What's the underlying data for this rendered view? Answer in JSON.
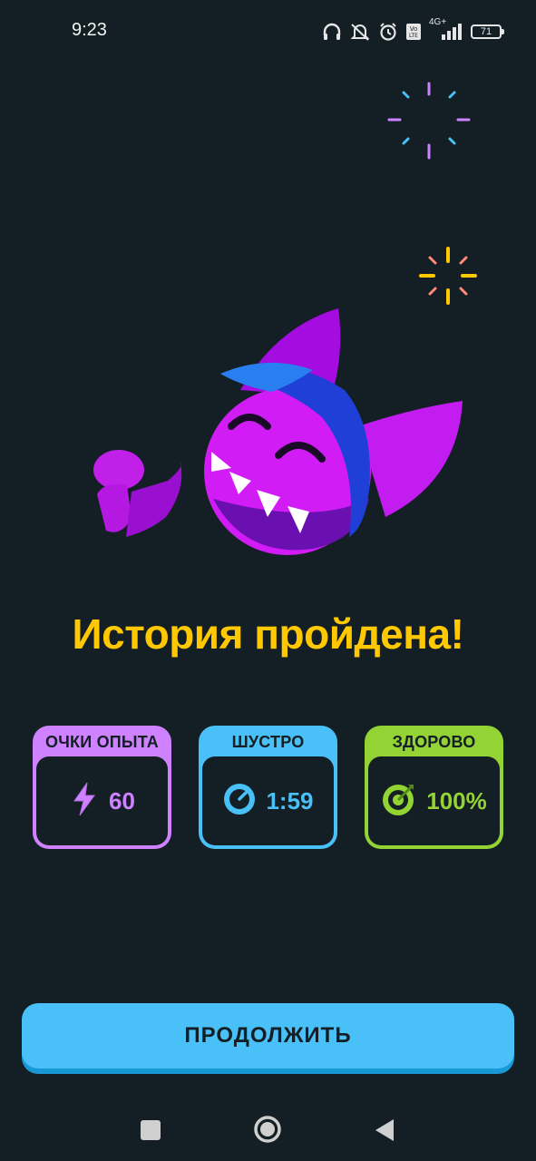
{
  "status_bar": {
    "time": "9:23",
    "battery": "71",
    "icons": [
      "headphones-icon",
      "muted-bell-icon",
      "alarm-icon",
      "volte-icon",
      "signal-4g-icon",
      "battery-icon"
    ],
    "network_label": "4G+"
  },
  "hero": {
    "mascot": "purple-shark-mascot-icon"
  },
  "title": "История пройдена!",
  "stats": [
    {
      "label": "ОЧКИ ОПЫТА",
      "value": "60",
      "icon": "lightning-icon",
      "color": "#ce82ff"
    },
    {
      "label": "ШУСТРО",
      "value": "1:59",
      "icon": "stopwatch-icon",
      "color": "#49c0f8"
    },
    {
      "label": "ЗДОРОВО",
      "value": "100%",
      "icon": "target-icon",
      "color": "#93d333"
    }
  ],
  "continue_button": {
    "label": "ПРОДОЛЖИТЬ",
    "color": "#49c0f8"
  },
  "nav_bar": {
    "buttons": [
      "recents-button",
      "home-button",
      "back-button"
    ]
  },
  "colors": {
    "background": "#131f24",
    "title": "#ffc800"
  }
}
